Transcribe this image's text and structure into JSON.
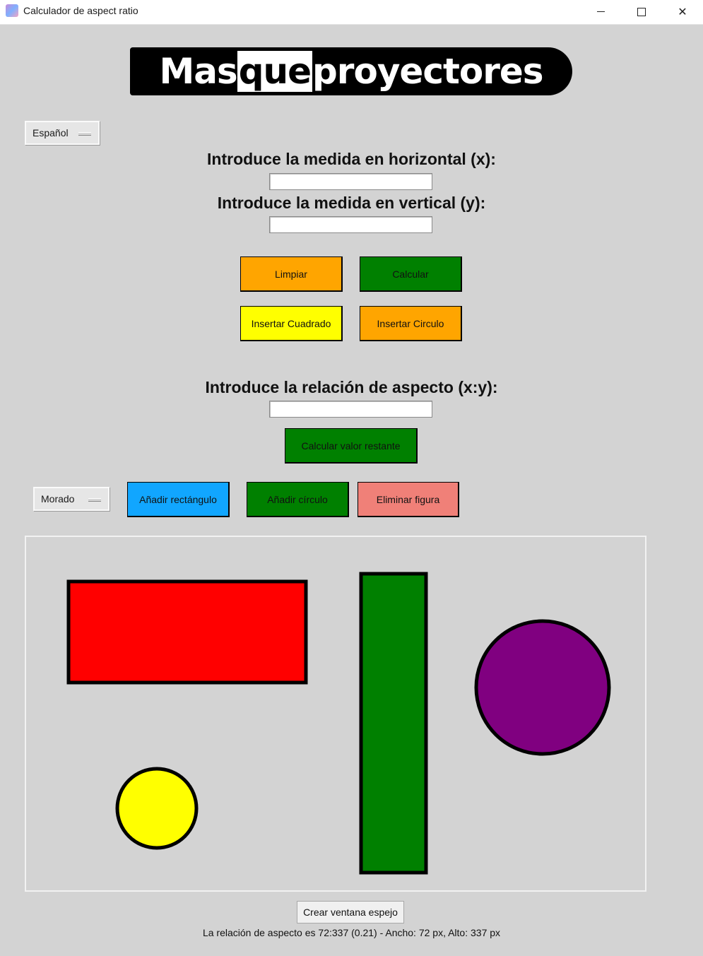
{
  "window": {
    "title": "Calculador de aspect ratio",
    "minimize_symbol": "",
    "close_symbol": "✕"
  },
  "logo": {
    "part1": "Mas",
    "part2": "que",
    "part3": "proyectores"
  },
  "language_menu": {
    "value": "Español"
  },
  "labels": {
    "horizontal": "Introduce la medida en horizontal (x):",
    "vertical": "Introduce la medida en vertical (y):",
    "ratio": "Introduce la relación de aspecto (x:y):"
  },
  "inputs": {
    "horizontal_value": "",
    "vertical_value": "",
    "ratio_value": ""
  },
  "buttons": {
    "clear": "Limpiar",
    "calculate": "Calcular",
    "insert_square": "Insertar Cuadrado",
    "insert_circle": "Insertar Circulo",
    "calculate_remaining": "Calcular valor restante",
    "add_rectangle": "Añadir rectángulo",
    "add_circle": "Añadir círculo",
    "delete_shape": "Eliminar figura",
    "mirror_window": "Crear ventana espejo"
  },
  "color_menu": {
    "value": "Morado"
  },
  "colors": {
    "orange": "#ffa500",
    "green": "#008000",
    "yellow": "#ffff00",
    "blue": "#11a6ff",
    "salmon": "#f08078",
    "red": "#ff0000",
    "purple": "#800080"
  },
  "canvas_shapes": [
    {
      "type": "rectangle",
      "fill": "red"
    },
    {
      "type": "rectangle",
      "fill": "green"
    },
    {
      "type": "circle",
      "fill": "purple"
    },
    {
      "type": "circle",
      "fill": "yellow"
    }
  ],
  "status": {
    "text": "La relación de aspecto es 72:337 (0.21) - Ancho: 72 px, Alto: 337 px"
  }
}
